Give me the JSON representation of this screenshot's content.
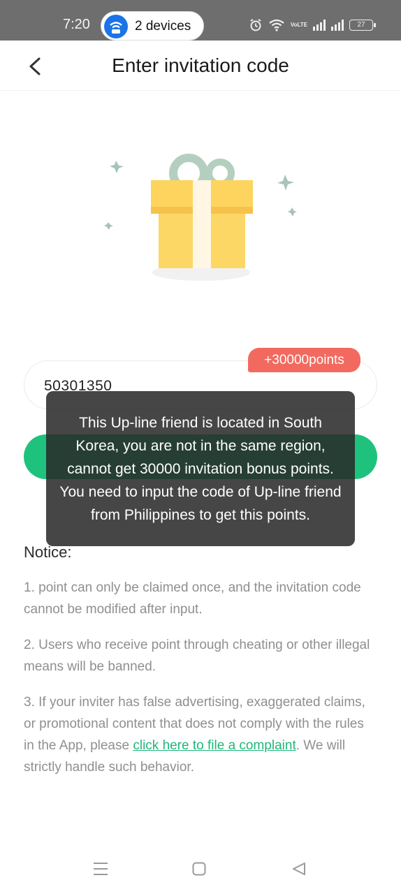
{
  "status_bar": {
    "time": "7:20",
    "hotspot_label": "2 devices",
    "volte_label": "VoLTE",
    "battery": "27"
  },
  "header": {
    "title": "Enter invitation code"
  },
  "invite": {
    "code_value": "50301350",
    "points_badge": "+30000points"
  },
  "toast": {
    "message": "This Up-line friend is located in South Korea, you are not in the same region, cannot get 30000 invitation bonus points. You need to input the code of Up-line friend from Philippines to get this points."
  },
  "notice": {
    "title": "Notice:",
    "item1": "1. point can only be claimed once, and the invitation code cannot be modified after input.",
    "item2": "2. Users who receive point through cheating or other illegal means will be banned.",
    "item3_before": "3. If your inviter has false advertising, exaggerated claims, or promotional content that does not comply with the rules in the App, please ",
    "item3_link": "click here to file a complaint",
    "item3_after": ". We will strictly handle such behavior."
  },
  "colors": {
    "accent_green": "#1fc27d",
    "badge_red": "#f26a5f",
    "status_bar": "#6e6e6e"
  }
}
